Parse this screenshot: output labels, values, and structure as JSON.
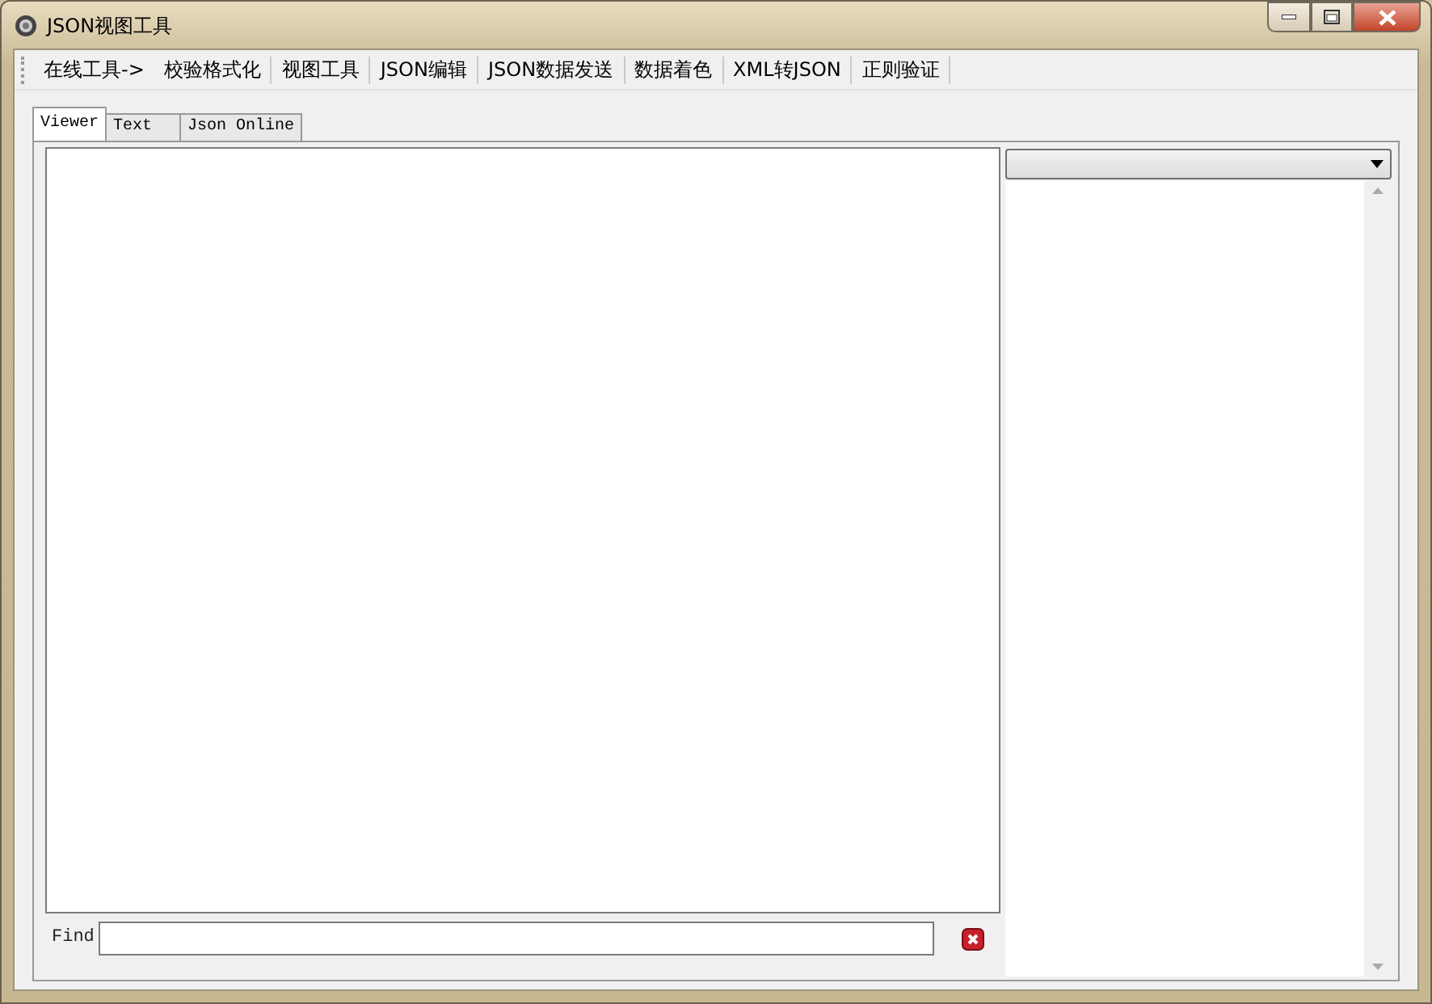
{
  "window": {
    "title": "JSON视图工具"
  },
  "menu": [
    {
      "label": "在线工具->"
    },
    {
      "label": "校验格式化"
    },
    {
      "label": "视图工具"
    },
    {
      "label": "JSON编辑"
    },
    {
      "label": "JSON数据发送"
    },
    {
      "label": "数据着色"
    },
    {
      "label": "XML转JSON"
    },
    {
      "label": "正则验证"
    }
  ],
  "tabs": [
    {
      "label": "Viewer",
      "selected": true
    },
    {
      "label": "Text",
      "selected": false
    },
    {
      "label": "Json Online",
      "selected": false
    }
  ],
  "find": {
    "label": "Find"
  }
}
